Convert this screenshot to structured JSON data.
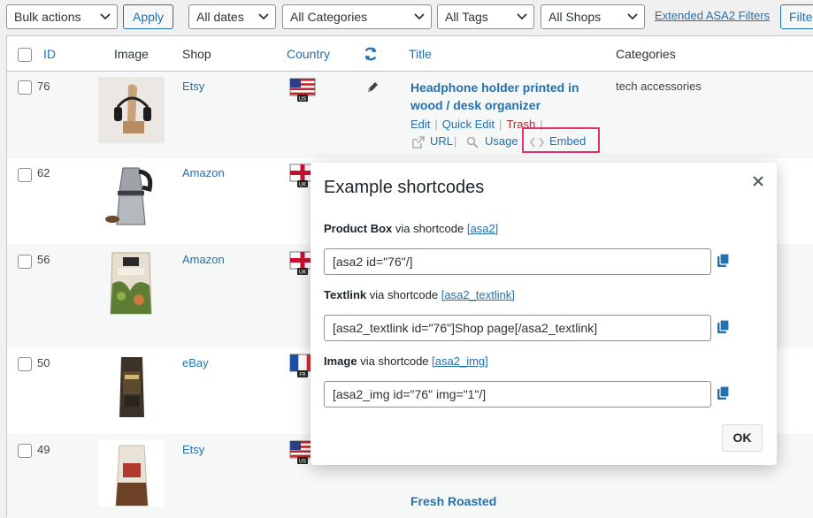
{
  "toolbar": {
    "bulk_actions": "Bulk actions",
    "apply": "Apply",
    "dates": "All dates",
    "categories": "All Categories",
    "tags": "All Tags",
    "shops": "All Shops",
    "extended_filters": "Extended ASA2 Filters",
    "filter": "Filte"
  },
  "columns": {
    "id": "ID",
    "image": "Image",
    "shop": "Shop",
    "country": "Country",
    "refresh_icon": "refresh-icon",
    "title": "Title",
    "categories": "Categories"
  },
  "rows": [
    {
      "id": "76",
      "shop": "Etsy",
      "country": "US",
      "title": "Headphone holder printed in wood / desk organizer",
      "category": "tech accessories",
      "image": "headphone-stand"
    },
    {
      "id": "62",
      "shop": "Amazon",
      "country": "UK",
      "image": "moka-pot"
    },
    {
      "id": "56",
      "shop": "Amazon",
      "country": "UK",
      "image": "coffee-bag-taylors"
    },
    {
      "id": "50",
      "shop": "eBay",
      "country": "FR",
      "image": "coffee-bag-dark"
    },
    {
      "id": "49",
      "shop": "Etsy",
      "country": "US",
      "title": "Fresh Roasted",
      "image": "coffee-bag-clear"
    }
  ],
  "row_actions": {
    "edit": "Edit",
    "quick_edit": "Quick Edit",
    "trash": "Trash",
    "url": "URL",
    "usage": "Usage",
    "embed": "Embed"
  },
  "modal": {
    "title": "Example shortcodes",
    "sections": [
      {
        "label": "Product Box",
        "via": "via shortcode",
        "shortcode": "[asa2]",
        "value": "[asa2 id=\"76\"/]"
      },
      {
        "label": "Textlink",
        "via": "via shortcode",
        "shortcode": "[asa2_textlink]",
        "value": "[asa2_textlink id=\"76\"]Shop page[/asa2_textlink]"
      },
      {
        "label": "Image",
        "via": "via shortcode",
        "shortcode": "[asa2_img]",
        "value": "[asa2_img id=\"76\" img=\"1\"/]"
      }
    ],
    "ok": "OK"
  },
  "colors": {
    "link": "#2271b1",
    "trash": "#b32d2e",
    "highlight": "#e1306c",
    "border": "#c3c4c7"
  }
}
